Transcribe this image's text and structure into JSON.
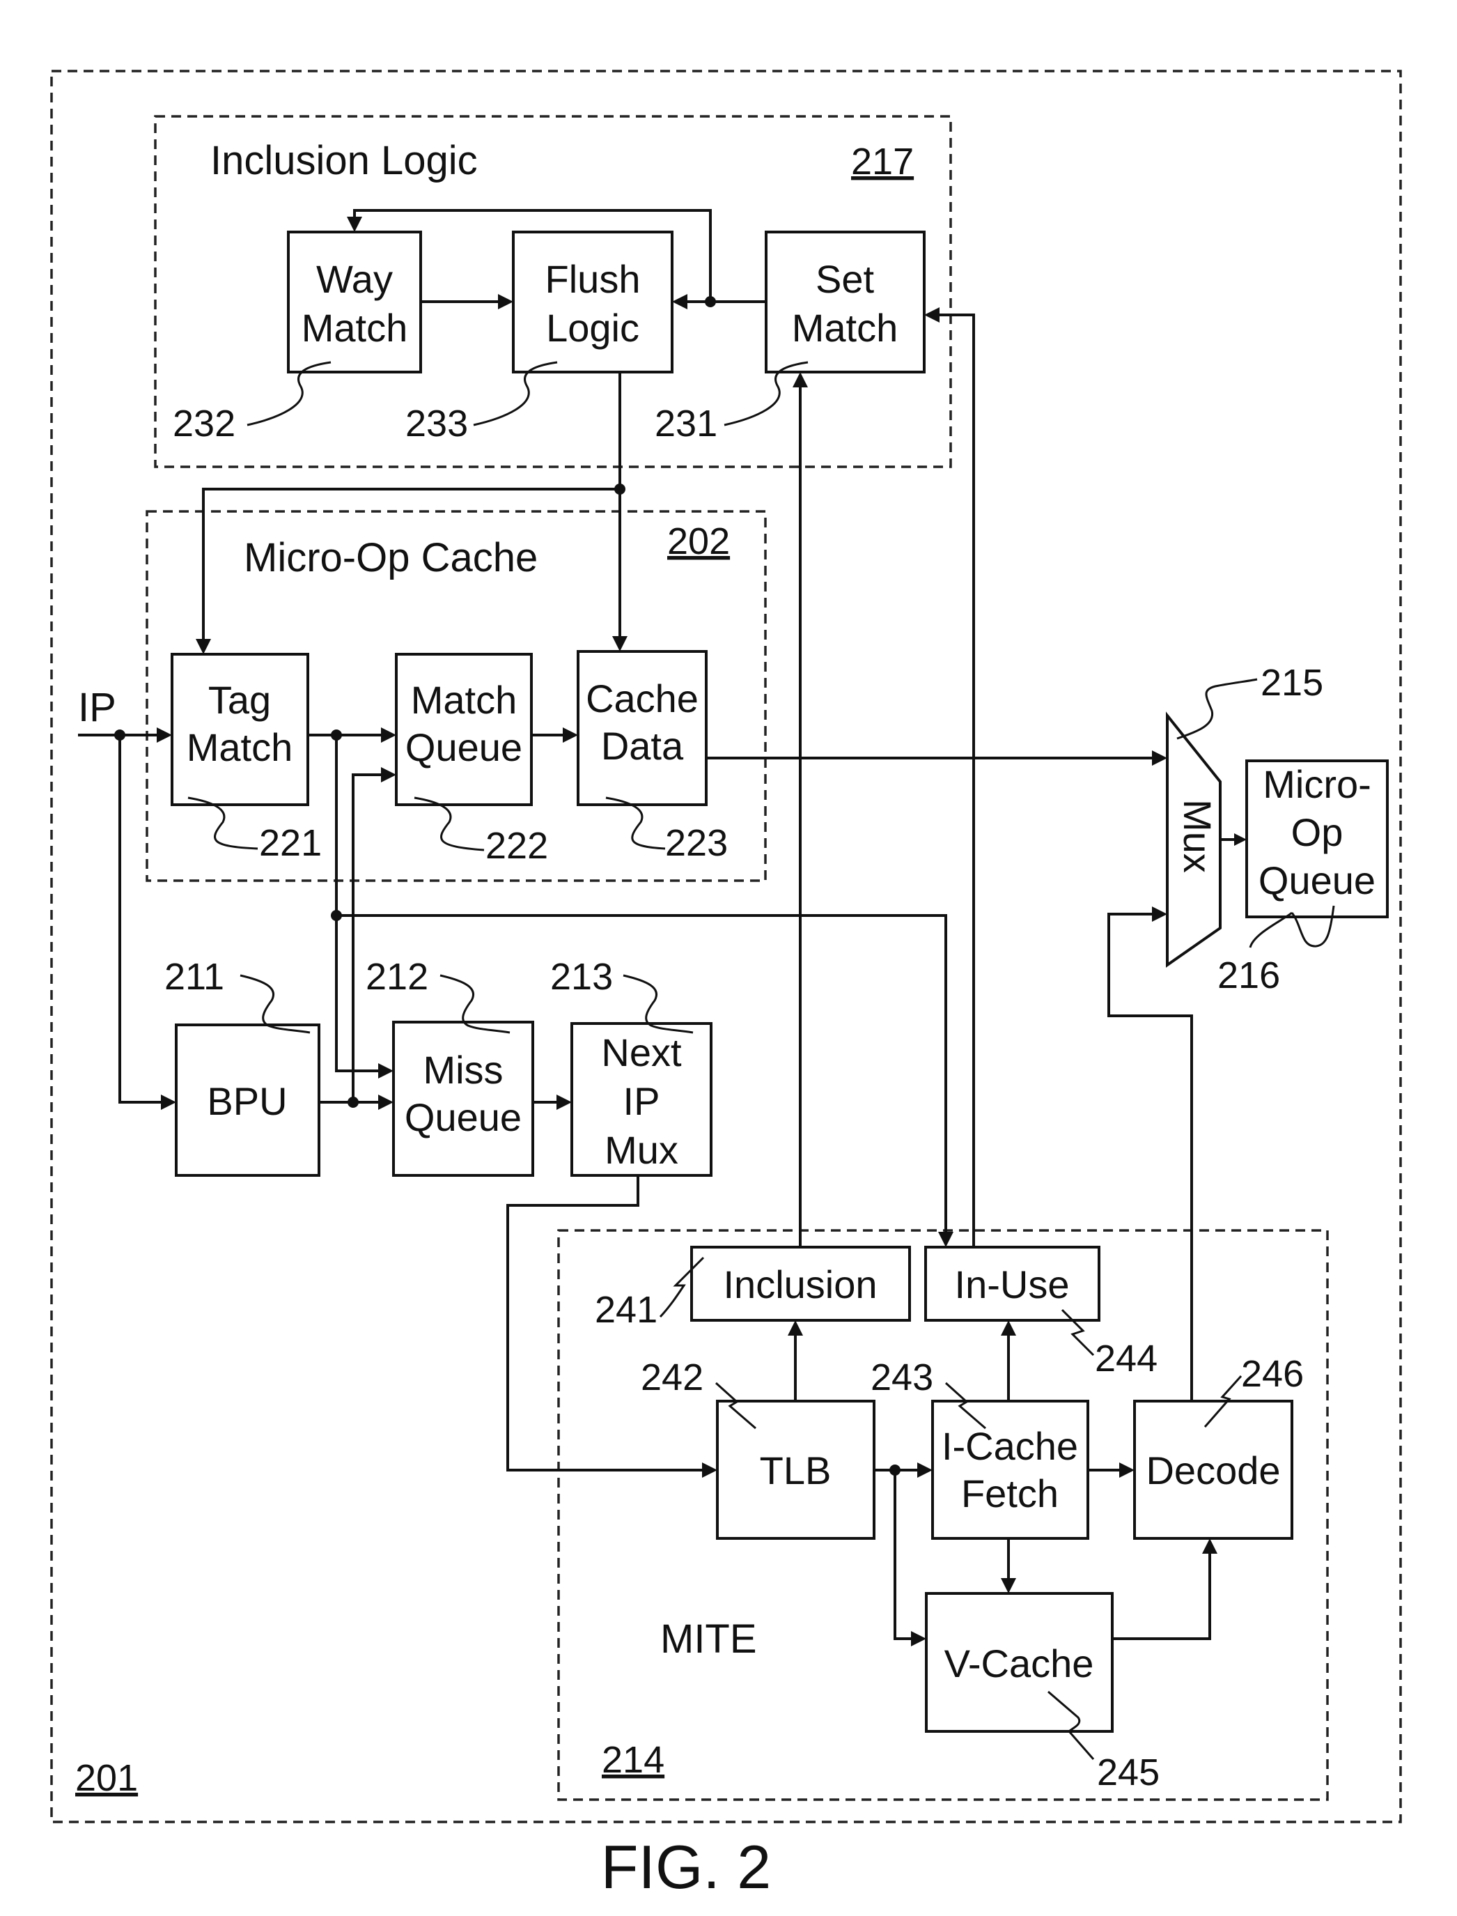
{
  "figure": {
    "caption": "FIG. 2",
    "outer_ref": "201"
  },
  "groups": {
    "inclusion_logic": {
      "title": "Inclusion Logic",
      "ref": "217"
    },
    "micro_op_cache": {
      "title": "Micro-Op Cache",
      "ref": "202"
    },
    "mite": {
      "title": "MITE",
      "ref": "214"
    }
  },
  "input": {
    "label": "IP"
  },
  "blocks": {
    "way_match": {
      "line1": "Way",
      "line2": "Match",
      "ref": "232"
    },
    "flush_logic": {
      "line1": "Flush",
      "line2": "Logic",
      "ref": "233"
    },
    "set_match": {
      "line1": "Set",
      "line2": "Match",
      "ref": "231"
    },
    "tag_match": {
      "line1": "Tag",
      "line2": "Match",
      "ref": "221"
    },
    "match_queue": {
      "line1": "Match",
      "line2": "Queue",
      "ref": "222"
    },
    "cache_data": {
      "line1": "Cache",
      "line2": "Data",
      "ref": "223"
    },
    "bpu": {
      "line1": "BPU",
      "ref": "211"
    },
    "miss_queue": {
      "line1": "Miss",
      "line2": "Queue",
      "ref": "212"
    },
    "next_ip_mux": {
      "line1": "Next",
      "line2": "IP",
      "line3": "Mux",
      "ref": "213"
    },
    "mux": {
      "line1": "Mux",
      "ref": "215"
    },
    "micro_op_queue": {
      "line1": "Micro-",
      "line2": "Op",
      "line3": "Queue",
      "ref": "216"
    },
    "inclusion": {
      "line1": "Inclusion",
      "ref": "241"
    },
    "in_use": {
      "line1": "In-Use",
      "ref": "244"
    },
    "tlb": {
      "line1": "TLB",
      "ref": "242"
    },
    "icache_fetch": {
      "line1": "I-Cache",
      "line2": "Fetch",
      "ref": "243"
    },
    "decode": {
      "line1": "Decode",
      "ref": "246"
    },
    "vcache": {
      "line1": "V-Cache",
      "ref": "245"
    }
  },
  "colors": {
    "ink": "#111111",
    "paper": "#ffffff"
  }
}
